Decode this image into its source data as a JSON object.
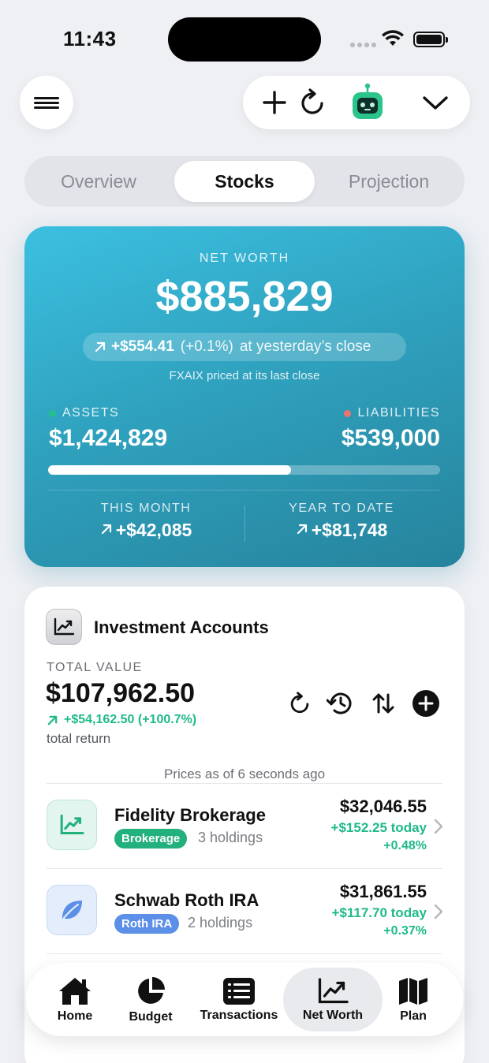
{
  "status_bar": {
    "time": "11:43"
  },
  "toolbar": {
    "menu_icon": "hamburger-icon",
    "add_icon": "plus-icon",
    "refresh_icon": "refresh-icon",
    "assistant_icon": "robot-icon",
    "expand_icon": "chevron-down-icon"
  },
  "tabs": [
    {
      "label": "Overview",
      "active": false
    },
    {
      "label": "Stocks",
      "active": true
    },
    {
      "label": "Projection",
      "active": false
    }
  ],
  "net_worth": {
    "label": "NET WORTH",
    "value": "$885,829",
    "change_amount": "+$554.41",
    "change_pct": "(+0.1%)",
    "change_suffix": "at yesterday’s close",
    "note": "FXAIX priced at its last close",
    "assets_label": "ASSETS",
    "assets_value": "$1,424,829",
    "liabilities_label": "LIABILITIES",
    "liabilities_value": "$539,000",
    "asset_ratio": 0.62,
    "this_month_label": "THIS MONTH",
    "this_month_value": "+$42,085",
    "ytd_label": "YEAR TO DATE",
    "ytd_value": "+$81,748",
    "colors": {
      "assets_dot": "#22c08a",
      "liabilities_dot": "#f07070"
    }
  },
  "investments": {
    "title": "Investment Accounts",
    "total_label": "TOTAL VALUE",
    "total_value": "$107,962.50",
    "total_return": "+$54,162.50 (+100.7%)",
    "total_return_label": "total return",
    "prices_note": "Prices as of 6 seconds ago",
    "accounts": [
      {
        "name": "Fidelity Brokerage",
        "tag": "Brokerage",
        "tag_color": "#22b07d",
        "holdings": "3 holdings",
        "value": "$32,046.55",
        "today": "+$152.25 today",
        "pct": "+0.48%",
        "icon": "chart-up-icon"
      },
      {
        "name": "Schwab Roth IRA",
        "tag": "Roth IRA",
        "tag_color": "#5b8fe8",
        "holdings": "2 holdings",
        "value": "$31,861.55",
        "today": "+$117.70 today",
        "pct": "+0.37%",
        "icon": "leaf-icon"
      }
    ]
  },
  "bottom_nav": [
    {
      "label": "Home",
      "icon": "home-icon",
      "active": false
    },
    {
      "label": "Budget",
      "icon": "pie-chart-icon",
      "active": false
    },
    {
      "label": "Transactions",
      "icon": "list-icon",
      "active": false
    },
    {
      "label": "Net Worth",
      "icon": "chart-up-icon",
      "active": true
    },
    {
      "label": "Plan",
      "icon": "map-icon",
      "active": false
    }
  ]
}
